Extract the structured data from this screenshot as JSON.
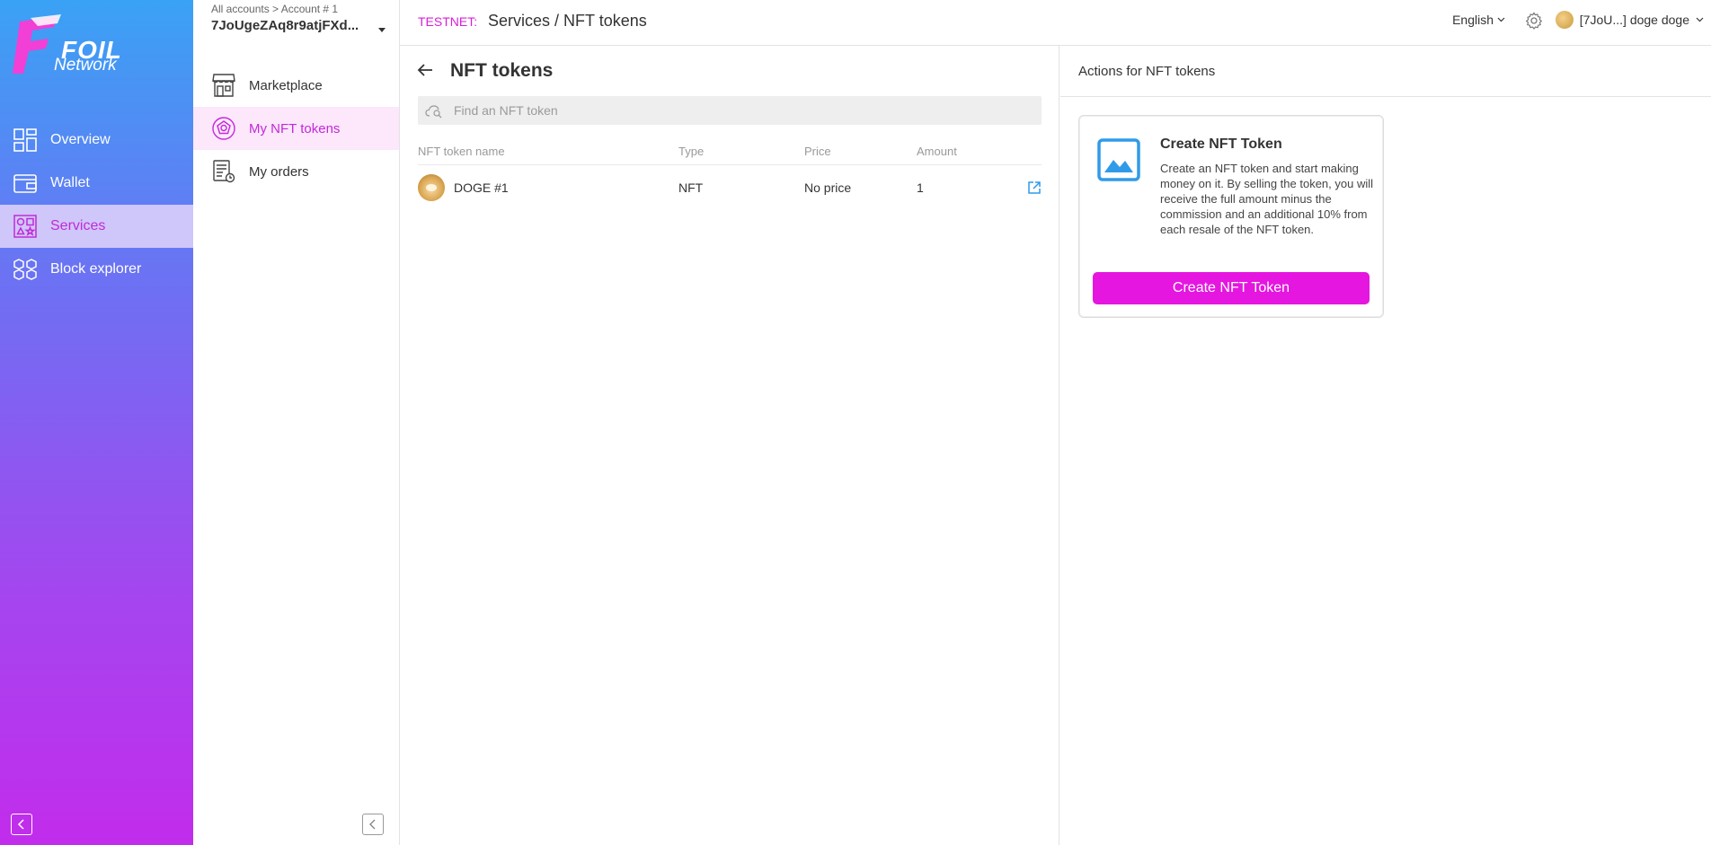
{
  "brand": {
    "logo_text": "FOIL",
    "logo_subtext": "Network"
  },
  "main_nav": [
    {
      "label": "Overview",
      "icon": "overview-grid-icon"
    },
    {
      "label": "Wallet",
      "icon": "wallet-icon"
    },
    {
      "label": "Services",
      "icon": "services-icon",
      "active": true
    },
    {
      "label": "Block explorer",
      "icon": "block-explorer-cubes-icon"
    }
  ],
  "account": {
    "breadcrumb": "All accounts > Account # 1",
    "address": "7JoUgeZAq8r9atjFXd..."
  },
  "sub_nav": [
    {
      "label": "Marketplace",
      "icon": "marketplace-store-icon"
    },
    {
      "label": "My NFT tokens",
      "icon": "nft-token-icon",
      "active": true
    },
    {
      "label": "My orders",
      "icon": "orders-list-icon"
    }
  ],
  "topbar": {
    "network": "TESTNET:",
    "title": "Services / NFT tokens",
    "language": "English",
    "user_label": "[7JoU...] doge doge"
  },
  "content": {
    "title": "NFT tokens",
    "search_placeholder": "Find an NFT token",
    "columns": [
      "NFT token name",
      "Type",
      "Price",
      "Amount"
    ],
    "rows": [
      {
        "name": "DOGE #1",
        "type": "NFT",
        "price": "No price",
        "amount": "1"
      }
    ]
  },
  "right_panel": {
    "header": "Actions for NFT tokens",
    "card": {
      "title": "Create NFT Token",
      "description": "Create an NFT token and start making money on it. By selling the token, you will receive the full amount minus the commission and an additional 10% from each resale of the NFT token.",
      "button_label": "Create NFT Token"
    }
  },
  "colors": {
    "accent": "#e516e0",
    "testnet": "#d81ed8",
    "link_icon": "#2f9be8"
  }
}
